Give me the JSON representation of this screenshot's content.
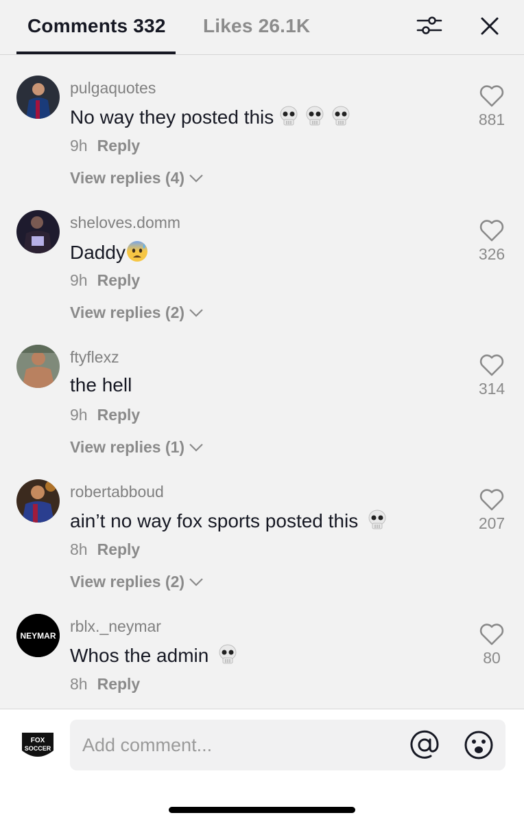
{
  "header": {
    "comments_tab": "Comments 332",
    "likes_tab": "Likes 26.1K",
    "filter_icon": "filter-sliders-icon",
    "close_icon": "close-icon"
  },
  "comments": [
    {
      "username": "pulgaquotes",
      "text": "No way they posted this",
      "emoji": [
        "skull",
        "skull",
        "skull"
      ],
      "time": "9h",
      "reply": "Reply",
      "view_replies": "View replies (4)",
      "likes": "881"
    },
    {
      "username": "sheloves.domm",
      "text": "Daddy",
      "emoji": [
        "anxious-face-with-sweat"
      ],
      "time": "9h",
      "reply": "Reply",
      "view_replies": "View replies (2)",
      "likes": "326"
    },
    {
      "username": "ftyflexz",
      "text": "the hell",
      "emoji": [],
      "time": "9h",
      "reply": "Reply",
      "view_replies": "View replies (1)",
      "likes": "314"
    },
    {
      "username": "robertabboud",
      "text": "ain’t no way fox sports posted this",
      "emoji": [
        "skull"
      ],
      "time": "8h",
      "reply": "Reply",
      "view_replies": "View replies (2)",
      "likes": "207"
    },
    {
      "username": "rblx._neymar",
      "text": "Whos the admin",
      "emoji": [
        "skull"
      ],
      "time": "8h",
      "reply": "Reply",
      "view_replies": "",
      "likes": "80"
    }
  ],
  "avatar_5_text": "NEYMAR",
  "composer": {
    "placeholder": "Add comment...",
    "avatar_logo_line1": "FOX",
    "avatar_logo_line2": "SOCCER"
  },
  "colors": {
    "text": "#161823",
    "muted": "#8a8a8a",
    "background": "#f2f2f2"
  }
}
